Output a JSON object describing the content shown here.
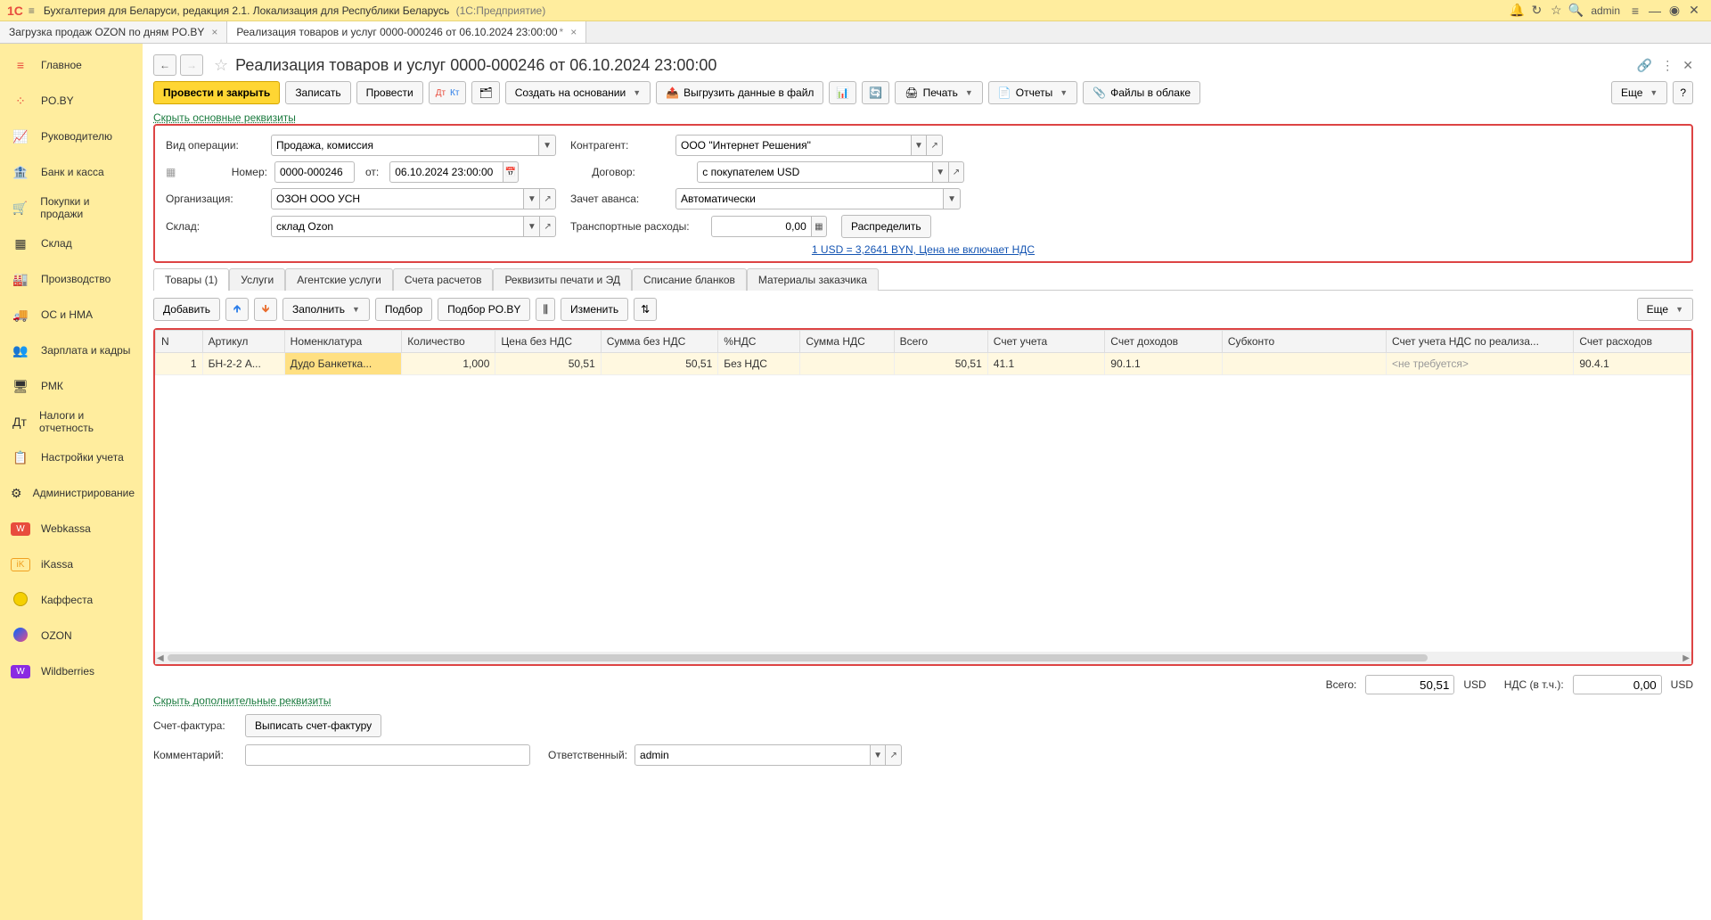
{
  "header": {
    "logo": "1C",
    "title": "Бухгалтерия для Беларуси, редакция 2.1. Локализация для Республики Беларусь",
    "product": "(1С:Предприятие)",
    "user": "admin"
  },
  "doc_tabs": [
    {
      "label": "Загрузка продаж OZON по дням PO.BY",
      "active": false,
      "modified": false
    },
    {
      "label": "Реализация товаров и услуг 0000-000246 от 06.10.2024 23:00:00",
      "active": true,
      "modified": true
    }
  ],
  "sidebar": [
    {
      "icon": "home",
      "label": "Главное",
      "color": "#e84c3d"
    },
    {
      "icon": "dots",
      "label": "PO.BY",
      "color": "#e84c3d"
    },
    {
      "icon": "chart",
      "label": "Руководителю",
      "color": "#555"
    },
    {
      "icon": "bank",
      "label": "Банк и касса",
      "color": "#555"
    },
    {
      "icon": "cart",
      "label": "Покупки и продажи",
      "color": "#555"
    },
    {
      "icon": "stock",
      "label": "Склад",
      "color": "#555"
    },
    {
      "icon": "factory",
      "label": "Производство",
      "color": "#555"
    },
    {
      "icon": "truck",
      "label": "ОС и НМА",
      "color": "#555"
    },
    {
      "icon": "people",
      "label": "Зарплата и кадры",
      "color": "#555"
    },
    {
      "icon": "rmk",
      "label": "РМК",
      "color": "#555"
    },
    {
      "icon": "tax",
      "label": "Налоги и отчетность",
      "color": "#555"
    },
    {
      "icon": "settings",
      "label": "Настройки учета",
      "color": "#555"
    },
    {
      "icon": "gear",
      "label": "Администрирование",
      "color": "#555"
    },
    {
      "icon": "wk",
      "label": "Webkassa",
      "color": "#e84c3d"
    },
    {
      "icon": "ik",
      "label": "iKassa",
      "color": "#f0a020"
    },
    {
      "icon": "kf",
      "label": "Каффеста",
      "color": "#f5d000"
    },
    {
      "icon": "oz",
      "label": "OZON",
      "color": "#0066ff"
    },
    {
      "icon": "wb",
      "label": "Wildberries",
      "color": "#8a2be2"
    }
  ],
  "document": {
    "title": "Реализация товаров и услуг 0000-000246 от 06.10.2024 23:00:00"
  },
  "toolbar": {
    "post_close": "Провести и закрыть",
    "save": "Записать",
    "post": "Провести",
    "create_based": "Создать на основании",
    "export_data": "Выгрузить данные в файл",
    "print": "Печать",
    "reports": "Отчеты",
    "files": "Файлы в облаке",
    "more": "Еще"
  },
  "hide_main": "Скрыть основные реквизиты",
  "form": {
    "op_type_lbl": "Вид операции:",
    "op_type": "Продажа, комиссия",
    "counterparty_lbl": "Контрагент:",
    "counterparty": "ООО \"Интернет Решения\"",
    "number_lbl": "Номер:",
    "number": "0000-000246",
    "from_lbl": "от:",
    "date": "06.10.2024 23:00:00",
    "contract_lbl": "Договор:",
    "contract": "с покупателем USD",
    "org_lbl": "Организация:",
    "org": "ОЗОН ООО УСН",
    "advance_lbl": "Зачет аванса:",
    "advance": "Автоматически",
    "warehouse_lbl": "Склад:",
    "warehouse": "склад Ozon",
    "transport_lbl": "Транспортные расходы:",
    "transport": "0,00",
    "distribute": "Распределить",
    "rate_link": "1 USD = 3,2641 BYN, Цена не включает НДС"
  },
  "inner_tabs": [
    "Товары (1)",
    "Услуги",
    "Агентские услуги",
    "Счета расчетов",
    "Реквизиты печати и ЭД",
    "Списание бланков",
    "Материалы заказчика"
  ],
  "tbl_toolbar": {
    "add": "Добавить",
    "fill": "Заполнить",
    "select": "Подбор",
    "select_poby": "Подбор PO.BY",
    "change": "Изменить",
    "more": "Еще"
  },
  "columns": [
    "N",
    "Артикул",
    "Номенклатура",
    "Количество",
    "Цена без НДС",
    "Сумма без НДС",
    "%НДС",
    "Сумма НДС",
    "Всего",
    "Счет учета",
    "Счет доходов",
    "Субконто",
    "Счет учета НДС по реализа...",
    "Счет расходов"
  ],
  "row": {
    "n": "1",
    "sku": "БН-2-2 А...",
    "nom": "Дудо Банкетка...",
    "qty": "1,000",
    "price": "50,51",
    "sum": "50,51",
    "vat": "Без НДС",
    "vat_sum": "",
    "total": "50,51",
    "acc": "41.1",
    "inc_acc": "90.1.1",
    "subconto": "",
    "vat_acc": "<не требуется>",
    "exp_acc": "90.4.1"
  },
  "totals": {
    "total_lbl": "Всего:",
    "total_val": "50,51",
    "total_cur": "USD",
    "vat_lbl": "НДС (в т.ч.):",
    "vat_val": "0,00",
    "vat_cur": "USD"
  },
  "hide_extra": "Скрыть дополнительные реквизиты",
  "footer": {
    "invoice_lbl": "Счет-фактура:",
    "invoice_btn": "Выписать счет-фактуру",
    "comment_lbl": "Комментарий:",
    "comment": "",
    "responsible_lbl": "Ответственный:",
    "responsible": "admin"
  }
}
